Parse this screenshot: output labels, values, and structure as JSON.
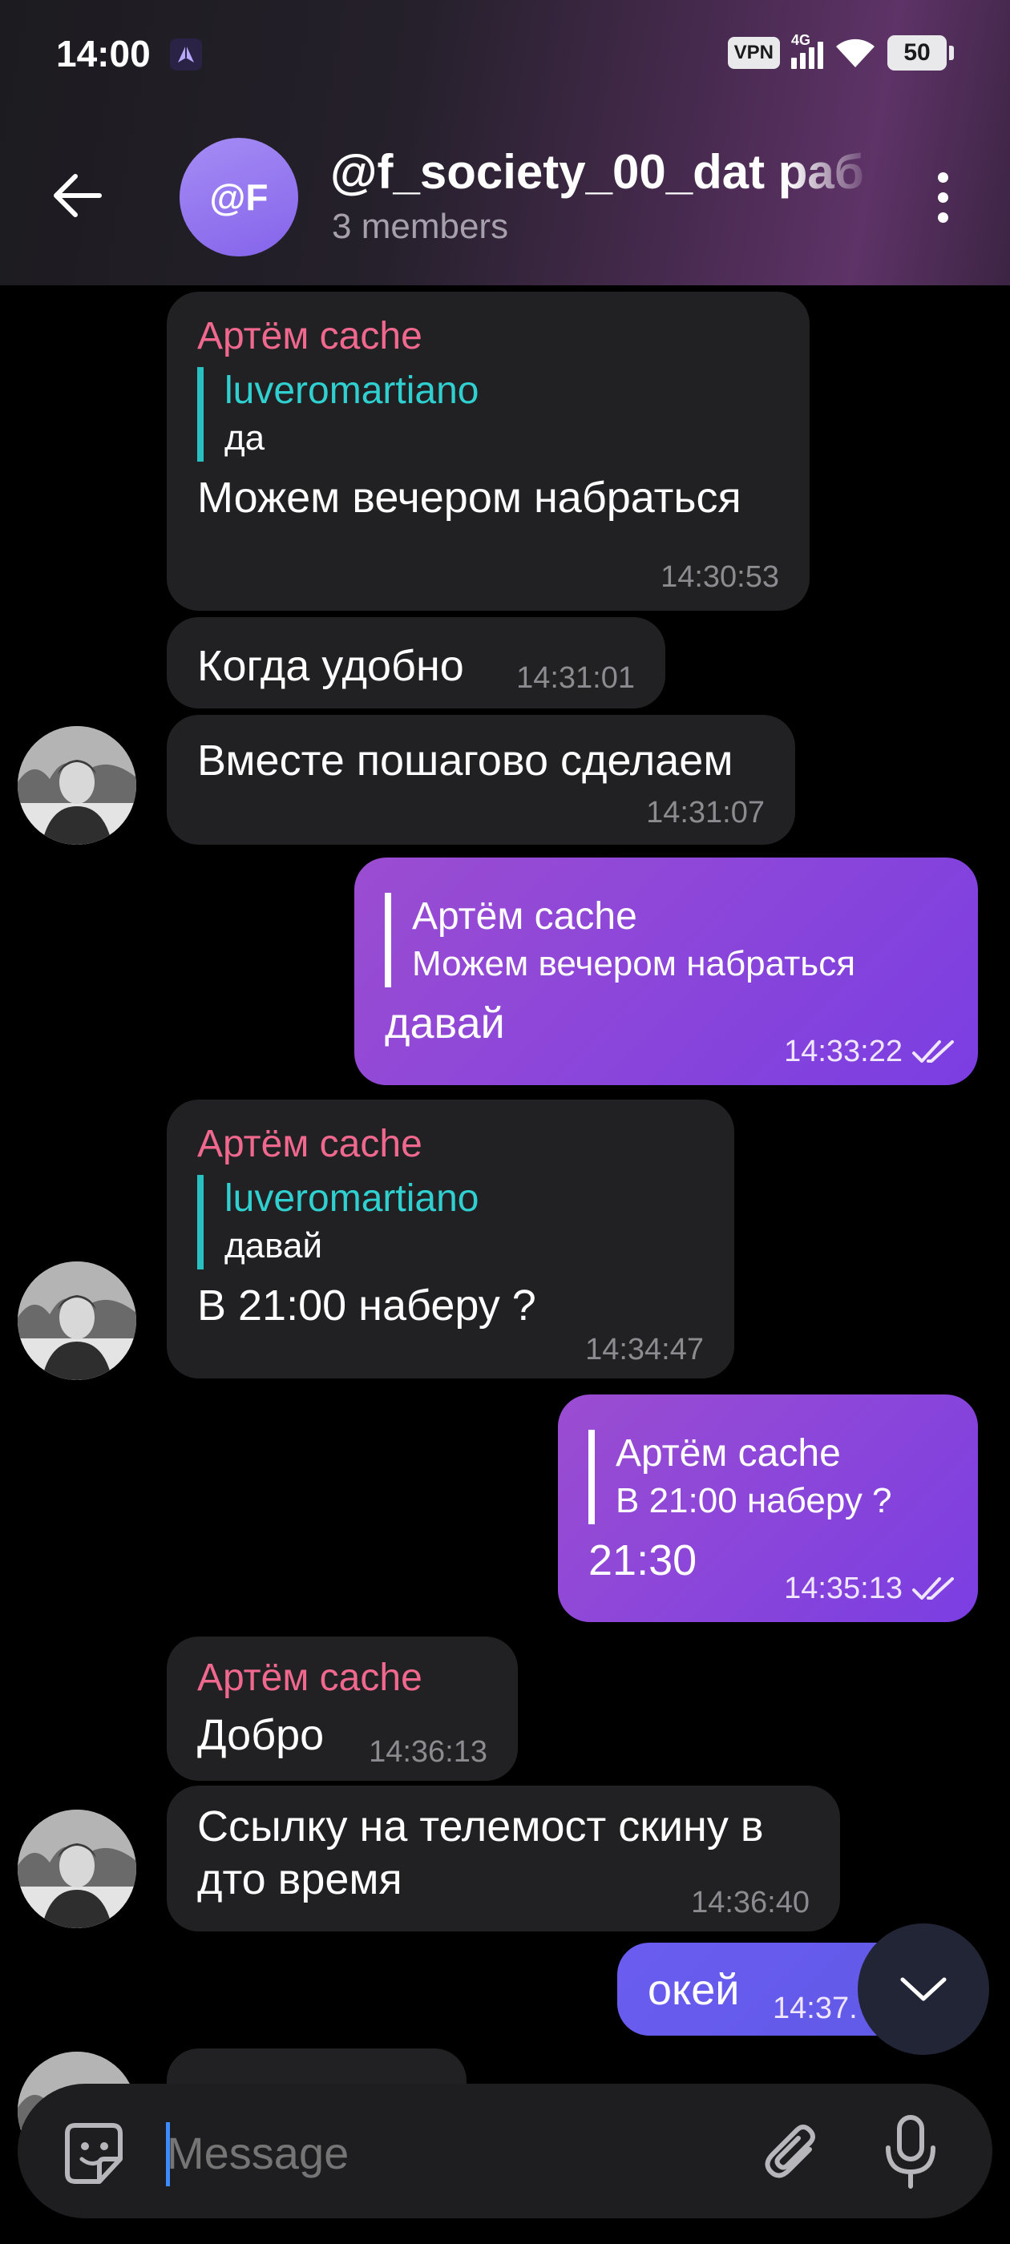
{
  "status_bar": {
    "time": "14:00",
    "vpn_label": "VPN",
    "network_label": "4G",
    "battery": "50"
  },
  "header": {
    "avatar_initials": "@F",
    "title": "@f_society_00_dat раб",
    "subtitle": "3 members"
  },
  "messages": [
    {
      "sender": "Артём cache",
      "quote_name": "luveromartiano",
      "quote_text": "да",
      "text": "Можем вечером набраться",
      "time": "14:30:53"
    },
    {
      "text": "Когда удобно",
      "time": "14:31:01"
    },
    {
      "text": "Вместе пошагово сделаем",
      "time": "14:31:07"
    },
    {
      "quote_name": "Артём cache",
      "quote_text": "Можем вечером набраться",
      "text": "давай",
      "time": "14:33:22"
    },
    {
      "sender": "Артём cache",
      "quote_name": "luveromartiano",
      "quote_text": "давай",
      "text": "В 21:00 наберу ?",
      "time": "14:34:47"
    },
    {
      "quote_name": "Артём cache",
      "quote_text": "В 21:00 наберу ?",
      "text": "21:30",
      "time": "14:35:13"
    },
    {
      "sender": "Артём cache",
      "text": "Добро",
      "time": "14:36:13"
    },
    {
      "text_line1": "Ссылку на телемост скину в",
      "text_line2": "дто время",
      "time": "14:36:40"
    },
    {
      "text": "окей",
      "time": "14:37."
    }
  ],
  "input": {
    "placeholder": "Message"
  },
  "icons": {
    "back": "arrow-left-icon",
    "menu": "more-vertical-icon",
    "sticker": "sticker-icon",
    "attach": "paperclip-icon",
    "mic": "microphone-icon",
    "scroll": "chevron-down-icon",
    "read": "double-check-icon"
  },
  "colors": {
    "sender_name": "#f0688d",
    "quote_name": "#2fd0cf",
    "outgoing_bubble": "#8a45d9",
    "incoming_bubble": "#212124",
    "avatar_group": "#9277f0"
  }
}
